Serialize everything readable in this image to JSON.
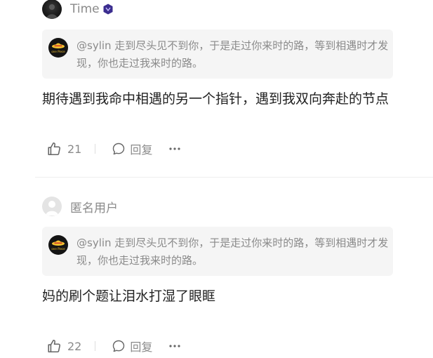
{
  "comments": [
    {
      "username": "Time",
      "avatar_icon": "dark-portrait-avatar",
      "level_badge_icon": "level-badge-icon",
      "quote": {
        "avatar_label": "one Piece",
        "text": "@sylin 走到尽头见不到你，于是走过你来时的路，等到相遇时才发现，你也走过我来时的路。"
      },
      "body": "期待遇到我命中相遇的另一个指针，遇到我双向奔赴的节点",
      "likes": "21",
      "reply_label": "回复"
    },
    {
      "username": "匿名用户",
      "avatar_icon": "anonymous-user-avatar",
      "quote": {
        "avatar_label": "one Piece",
        "text": "@sylin 走到尽头见不到你，于是走过你来时的路，等到相遇时才发现，你也走过我来时的路。"
      },
      "body": "妈的刷个题让泪水打湿了眼眶",
      "likes": "22",
      "reply_label": "回复"
    }
  ],
  "colors": {
    "meta_text": "#8a8a8a",
    "body_text": "#222222",
    "quote_bg": "#f5f5f5",
    "badge": "#3b2d8f"
  }
}
